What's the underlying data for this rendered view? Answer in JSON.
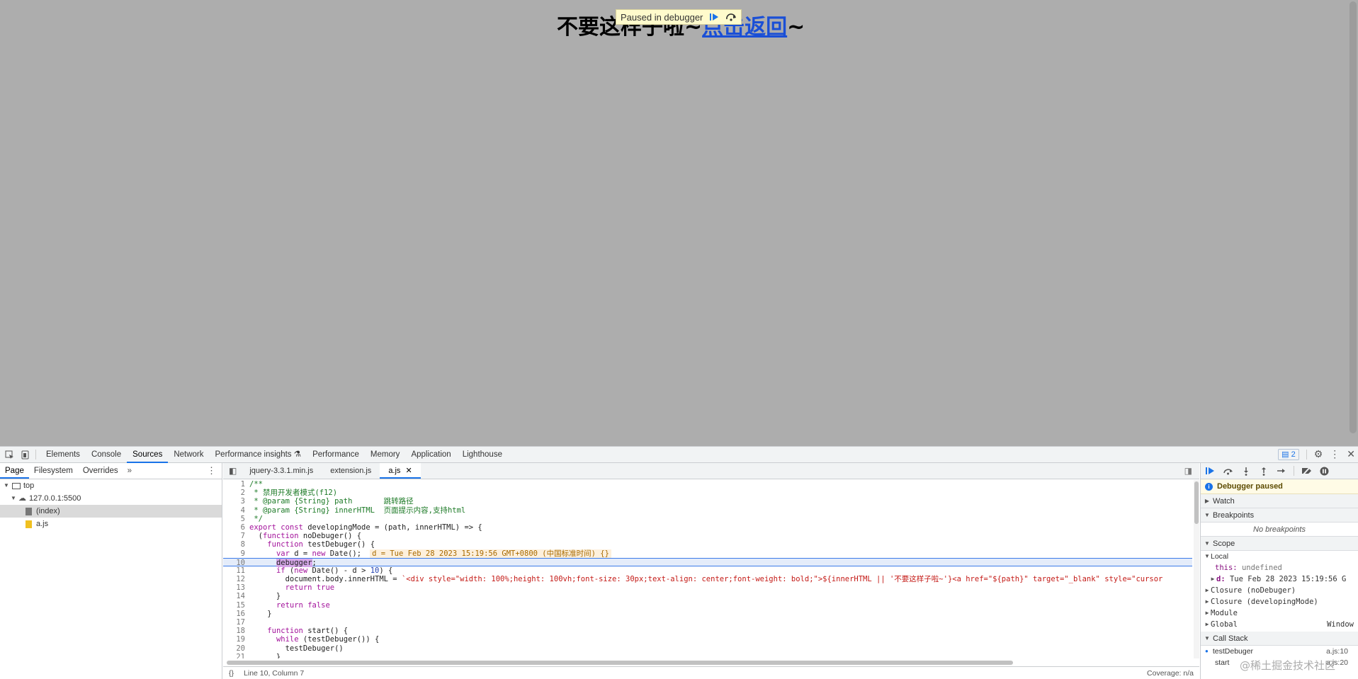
{
  "page": {
    "title_text": "不要这样子啦~",
    "link_text": "点击返回",
    "tilde": "~",
    "paused_overlay_label": "Paused in debugger"
  },
  "devtools": {
    "main_tabs": [
      "Elements",
      "Console",
      "Sources",
      "Network",
      "Performance insights",
      "Performance",
      "Memory",
      "Application",
      "Lighthouse"
    ],
    "active_tab": "Sources",
    "issues_count": "2",
    "navigator_tabs": [
      "Page",
      "Filesystem",
      "Overrides"
    ],
    "tree": {
      "top": "top",
      "host": "127.0.0.1:5500",
      "index": "(index)",
      "file": "a.js"
    },
    "editor_tabs": [
      "jquery-3.3.1.min.js",
      "extension.js",
      "a.js"
    ],
    "active_editor_tab": "a.js",
    "code_lines": [
      "/**",
      " * 禁用开发者模式(f12)",
      " * @param {String} path       跳转路径",
      " * @param {String} innerHTML  页面提示内容,支持html",
      " */",
      "export const developingMode = (path, innerHTML) => {",
      "  (function noDebuger() {",
      "    function testDebuger() {",
      "      var d = new Date();",
      "      debugger;",
      "      if (new Date() - d > 10) {",
      "        document.body.innerHTML = `<div style=\"width: 100%;height: 100vh;font-size: 30px;text-align: center;font-weight: bold;\">${innerHTML || '不要这样子啦~'}<a href=\"${path}\" target=\"_blank\" style=\"cursor",
      "        return true",
      "      }",
      "      return false",
      "    }",
      "",
      "    function start() {",
      "      while (testDebuger()) {",
      "        testDebuger()",
      "      }"
    ],
    "inline_value": "d = Tue Feb 28 2023 15:19:56 GMT+0800 (中国标准时间) {}",
    "status_position": "Line 10, Column 7",
    "status_coverage": "Coverage: n/a",
    "debugger": {
      "paused_label": "Debugger paused",
      "watch": "Watch",
      "breakpoints": "Breakpoints",
      "no_breakpoints": "No breakpoints",
      "scope": "Scope",
      "local": "Local",
      "this_key": "this:",
      "this_val": "undefined",
      "d_key": "d:",
      "d_val": "Tue Feb 28 2023 15:19:56 G",
      "closures": [
        "Closure (noDebuger)",
        "Closure (developingMode)",
        "Module"
      ],
      "global": "Global",
      "global_val": "Window",
      "call_stack": "Call Stack",
      "stack": [
        {
          "fn": "testDebuger",
          "loc": "a.js:10"
        },
        {
          "fn": "start",
          "loc": "a.js:20"
        }
      ]
    }
  },
  "watermark": "@稀土掘金技术社区"
}
